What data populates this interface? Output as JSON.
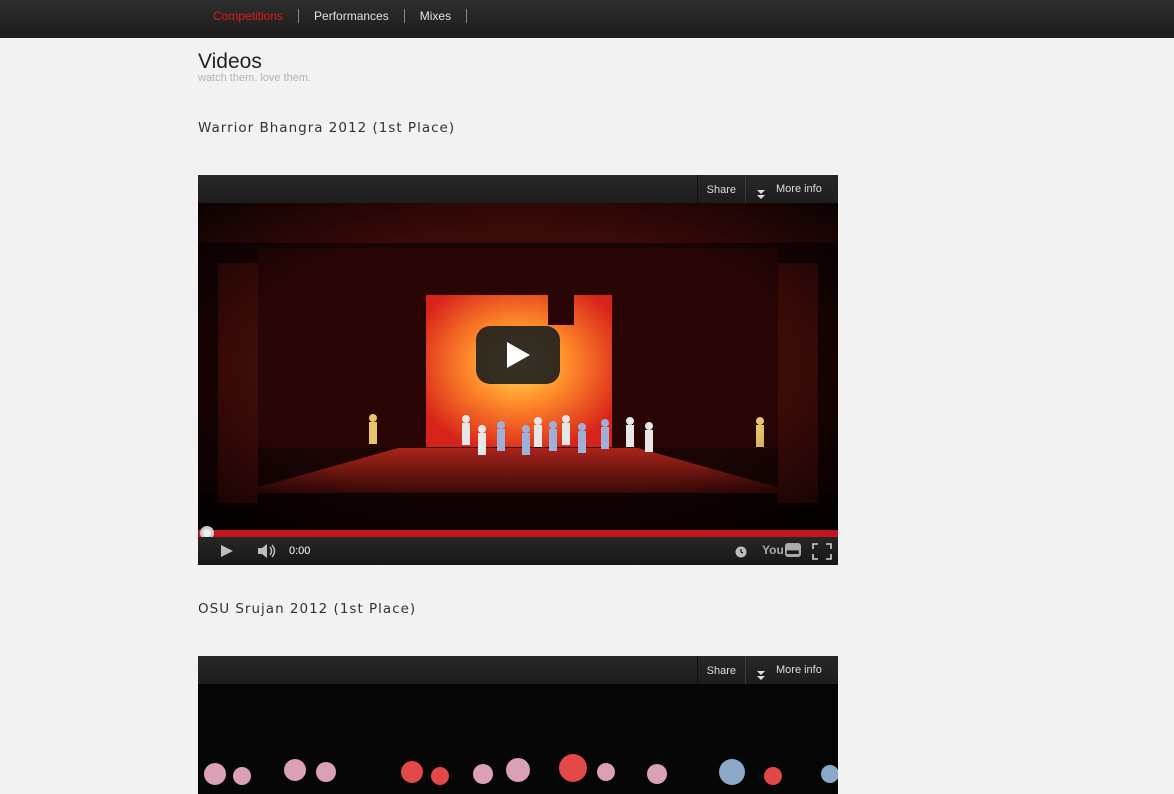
{
  "nav": {
    "items": [
      {
        "label": "Competitions",
        "active": true
      },
      {
        "label": "Performances",
        "active": false
      },
      {
        "label": "Mixes",
        "active": false
      }
    ]
  },
  "page": {
    "title": "Videos",
    "subtitle": "watch them. love them."
  },
  "videos": [
    {
      "title": "Warrior Bhangra 2012 (1st Place)",
      "share_label": "Share",
      "more_info_label": "More info",
      "time": "0:00",
      "brand": "You"
    },
    {
      "title": "OSU Srujan 2012 (1st Place)",
      "share_label": "Share",
      "more_info_label": "More info"
    }
  ],
  "icons": [
    "play-icon",
    "volume-icon",
    "clock-icon",
    "youtube-logo-icon",
    "fullscreen-icon",
    "chevron-down-icon"
  ],
  "colors": {
    "accent": "#e11b1b",
    "progress": "#c4161a"
  }
}
